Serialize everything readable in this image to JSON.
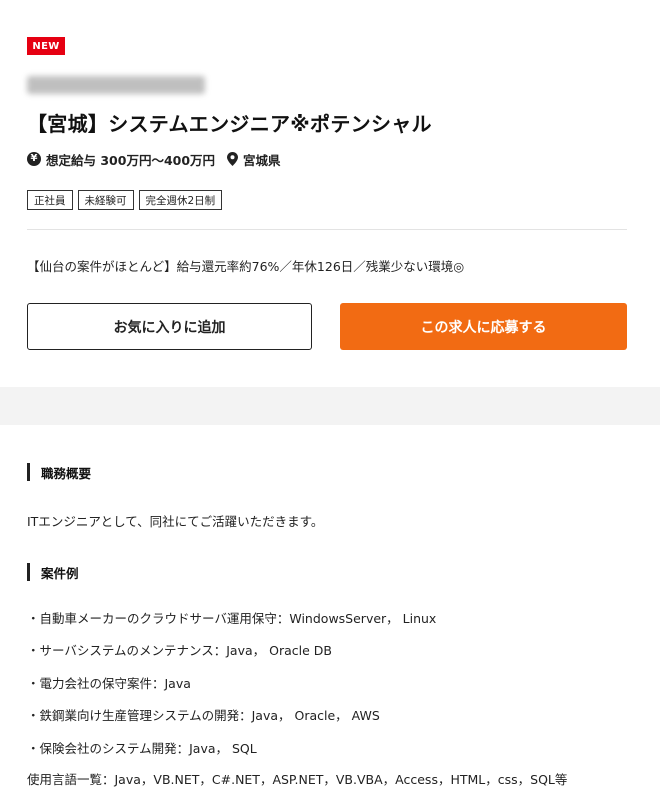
{
  "badge": {
    "new_label": "NEW"
  },
  "job": {
    "title": "【宮城】システムエンジニア※ポテンシャル",
    "salary": "想定給与 300万円～400万円",
    "location": "宮城県",
    "tags": [
      "正社員",
      "未経験可",
      "完全週休2日制"
    ],
    "catch_copy": "【仙台の案件がほとんど】給与還元率約76%／年休126日／残業少ない環境◎"
  },
  "actions": {
    "favorite_label": "お気に入りに追加",
    "apply_label": "この求人に応募する"
  },
  "sections": {
    "overview": {
      "heading": "職務概要",
      "text": "ITエンジニアとして、同社にてご活躍いただきます。"
    },
    "examples": {
      "heading": "案件例",
      "items": [
        "・自動車メーカーのクラウドサーバ運用保守：WindowsServer， Linux",
        "・サーバシステムのメンテナンス：Java， Oracle DB",
        "・電力会社の保守案件：Java",
        "・鉄鋼業向け生産管理システムの開発：Java， Oracle， AWS",
        "・保険会社のシステム開発：Java， SQL"
      ],
      "languages": "使用言語一覧：Java，VB.NET，C#.NET，ASP.NET，VB.VBA，Access，HTML，css，SQL等"
    }
  },
  "colors": {
    "accent": "#f26b13",
    "badge": "#e60012"
  },
  "icons": {
    "salary": "yen-circle-icon",
    "location": "map-pin-icon"
  }
}
